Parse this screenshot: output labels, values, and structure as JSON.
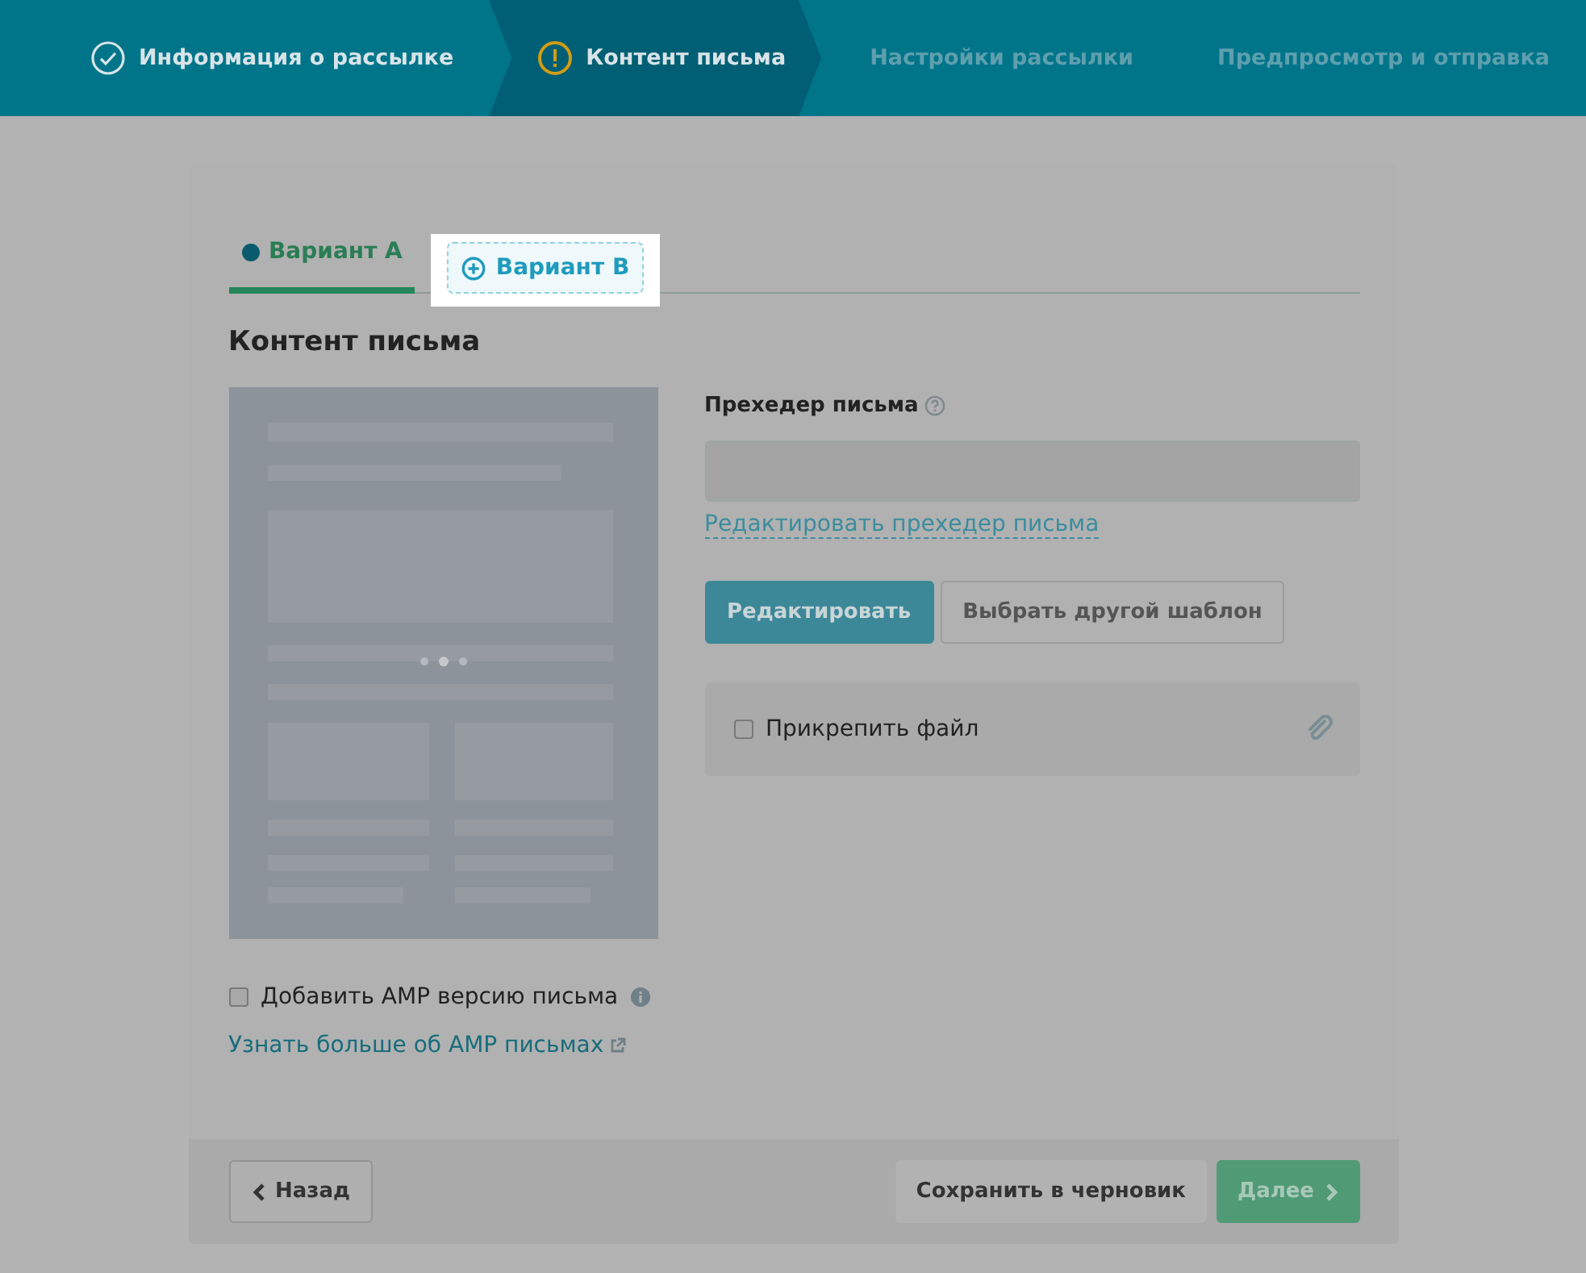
{
  "steps": [
    {
      "label": "Информация о рассылке",
      "kind": "done",
      "selected": false
    },
    {
      "label": "Контент письма",
      "kind": "warning",
      "selected": true
    },
    {
      "label": "Настройки рассылки",
      "kind": "upcoming",
      "selected": false
    },
    {
      "label": "Предпросмотр и отправка",
      "kind": "upcoming",
      "selected": false
    }
  ],
  "tabs": [
    {
      "label": "Вариант A",
      "kind": "variant",
      "selected": true
    },
    {
      "label": "Вариант B",
      "kind": "add",
      "selected": false
    }
  ],
  "section_title": "Контент письма",
  "preheader": {
    "label": "Прехедер письма",
    "edit_link": "Редактировать прехедер письма"
  },
  "buttons": [
    {
      "label": "Редактировать",
      "kind": "primary"
    },
    {
      "label": "Выбрать другой шаблон",
      "kind": "secondary"
    }
  ],
  "attach": {
    "label": "Прикрепить файл",
    "checked": false
  },
  "amp": {
    "label": "Добавить AMP версию письма",
    "checked": false,
    "link": "Узнать больше об AMP письмах"
  },
  "footer": {
    "back": "Назад",
    "save": "Сохранить в черновик",
    "next": "Далее"
  }
}
